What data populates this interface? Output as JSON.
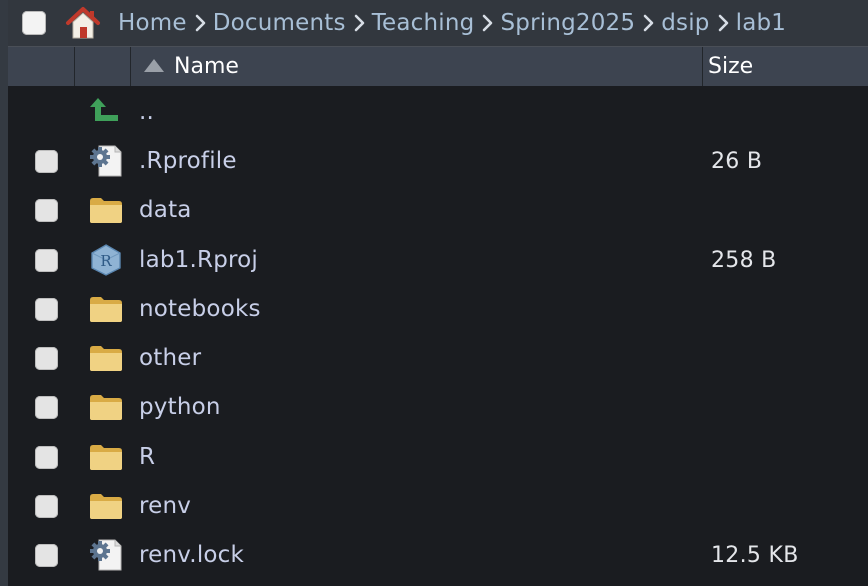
{
  "breadcrumb": {
    "items": [
      "Home",
      "Documents",
      "Teaching",
      "Spring2025",
      "dsip",
      "lab1"
    ]
  },
  "columns": {
    "name": "Name",
    "size": "Size"
  },
  "up_label": "..",
  "files": [
    {
      "name": ".Rprofile",
      "size": "26 B",
      "icon": "settings-file-icon"
    },
    {
      "name": "data",
      "size": "",
      "icon": "folder-icon"
    },
    {
      "name": "lab1.Rproj",
      "size": "258 B",
      "icon": "r-project-icon"
    },
    {
      "name": "notebooks",
      "size": "",
      "icon": "folder-icon"
    },
    {
      "name": "other",
      "size": "",
      "icon": "folder-icon"
    },
    {
      "name": "python",
      "size": "",
      "icon": "folder-icon"
    },
    {
      "name": "R",
      "size": "",
      "icon": "folder-icon"
    },
    {
      "name": "renv",
      "size": "",
      "icon": "folder-icon"
    },
    {
      "name": "renv.lock",
      "size": "12.5 KB",
      "icon": "settings-file-icon"
    }
  ],
  "colors": {
    "folder": "#e7c46e",
    "breadcrumb_text": "#a8bfd6",
    "file_text": "#c8cfe8",
    "up_arrow": "#3fa05a",
    "home_roof": "#c0392b"
  }
}
